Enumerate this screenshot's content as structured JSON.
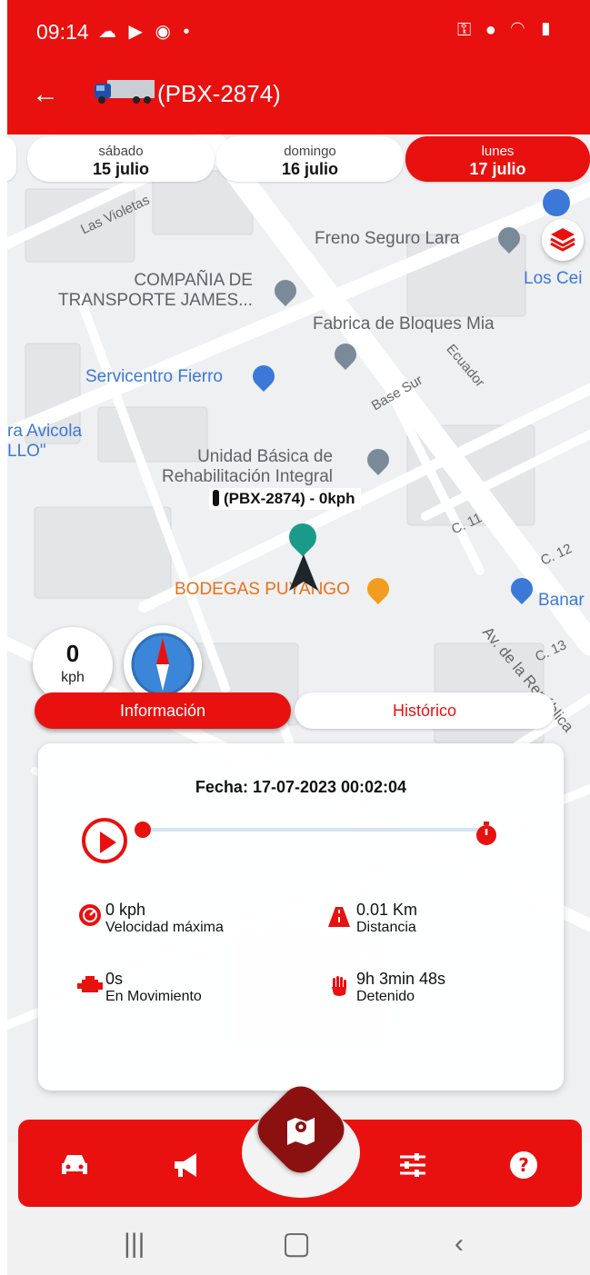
{
  "status_bar": {
    "time": "09:14"
  },
  "header": {
    "title": "(PBX-2874)"
  },
  "dates": [
    {
      "day": "sábado",
      "date": "15 julio",
      "active": false
    },
    {
      "day": "domingo",
      "date": "16 julio",
      "active": false
    },
    {
      "day": "lunes",
      "date": "17 julio",
      "active": true
    }
  ],
  "map": {
    "places": {
      "freno": "Freno Seguro Lara",
      "losceibos": "Los Cei",
      "compania": "COMPAÑIA DE\nTRANSPORTE JAMES...",
      "fabrica": "Fabrica de Bloques Mia",
      "servicentro": "Servicentro Fierro",
      "avicola": "ra Avicola\nLLO\"",
      "unidad": "Unidad Básica de\nRehabilitación Integral",
      "bodegas": "BODEGAS PUYANGO",
      "banar": "Banar"
    },
    "streets": {
      "violetas": "Las Violetas",
      "ecuador": "Ecuador",
      "basesur": "Base Sur",
      "c11": "C. 11",
      "c12": "C. 12",
      "c13": "C. 13",
      "avrep": "Av. de la República"
    },
    "vehicle_label": "(PBX-2874) - 0kph"
  },
  "speed": {
    "value": "0",
    "unit": "kph"
  },
  "tabs": {
    "info": "Información",
    "history": "Histórico"
  },
  "card": {
    "date": "Fecha: 17-07-2023 00:02:04",
    "stats": {
      "max_speed": {
        "value": "0 kph",
        "label": "Velocidad máxima"
      },
      "distance": {
        "value": "0.01 Km",
        "label": "Distancia"
      },
      "moving": {
        "value": "0s",
        "label": "En Movimiento"
      },
      "stopped": {
        "value": "9h 3min 48s",
        "label": "Detenido"
      }
    }
  },
  "colors": {
    "primary": "#e8110f",
    "dark": "#8b1111",
    "accent_blue": "#3b78d8"
  }
}
